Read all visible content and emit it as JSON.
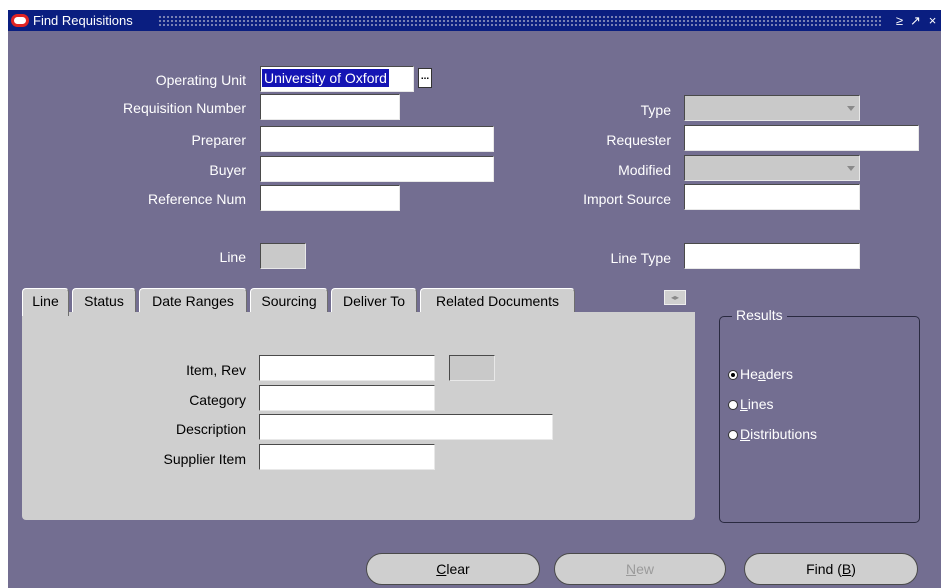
{
  "window": {
    "title": "Find Requisitions",
    "controls": [
      "≥",
      "↗",
      "×"
    ]
  },
  "header_fields": {
    "operating_unit": {
      "label": "Operating Unit",
      "value": "University of Oxford"
    },
    "requisition_number": {
      "label": "Requisition Number",
      "value": ""
    },
    "preparer": {
      "label": "Preparer",
      "value": ""
    },
    "buyer": {
      "label": "Buyer",
      "value": ""
    },
    "reference_num": {
      "label": "Reference Num",
      "value": ""
    },
    "type": {
      "label": "Type",
      "value": ""
    },
    "requester": {
      "label": "Requester",
      "value": ""
    },
    "modified": {
      "label": "Modified",
      "value": ""
    },
    "import_source": {
      "label": "Import Source",
      "value": ""
    },
    "line": {
      "label": "Line",
      "value": ""
    },
    "line_type": {
      "label": "Line Type",
      "value": ""
    }
  },
  "lov_button_label": "...",
  "tabs": [
    {
      "label": "Line",
      "active": true
    },
    {
      "label": "Status"
    },
    {
      "label": "Date Ranges"
    },
    {
      "label": "Sourcing"
    },
    {
      "label": "Deliver To"
    },
    {
      "label": "Related Documents"
    }
  ],
  "tab_scroll_label": "◂▸",
  "line_tab": {
    "item_rev": {
      "label": "Item, Rev",
      "value": "",
      "rev": ""
    },
    "category": {
      "label": "Category",
      "value": ""
    },
    "description": {
      "label": "Description",
      "value": ""
    },
    "supplier_item": {
      "label": "Supplier Item",
      "value": ""
    }
  },
  "results": {
    "title": "Results",
    "options": [
      {
        "label_pre": "He",
        "label_ul": "a",
        "label_post": "ders",
        "selected": true
      },
      {
        "label_pre": "",
        "label_ul": "L",
        "label_post": "ines",
        "selected": false
      },
      {
        "label_pre": "",
        "label_ul": "D",
        "label_post": "istributions",
        "selected": false
      }
    ]
  },
  "buttons": {
    "clear": {
      "pre": "",
      "ul": "C",
      "post": "lear"
    },
    "new": {
      "pre": "",
      "ul": "N",
      "post": "ew"
    },
    "find": {
      "pre": "Find (",
      "ul": "B",
      "post": ")"
    }
  },
  "colors": {
    "window_background": "#736E91",
    "titlebar": "#0A1E80",
    "selection": "#1414B4",
    "panel": "#CFCFCF"
  }
}
